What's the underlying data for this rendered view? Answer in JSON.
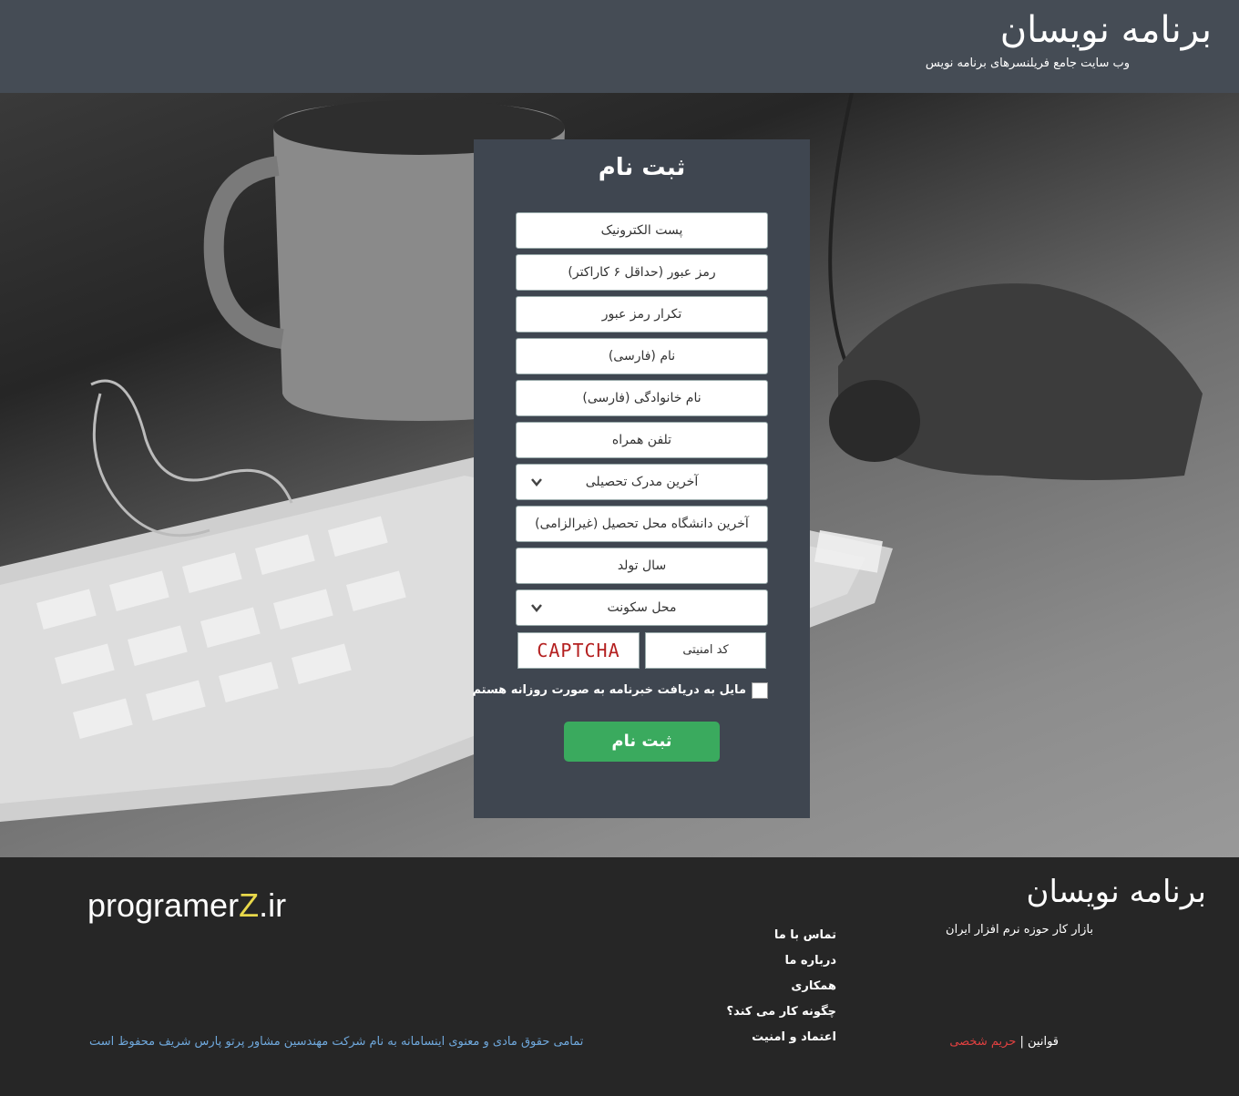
{
  "header": {
    "logo": "برنامه نویسان",
    "tagline": "وب سایت جامع فریلنسرهای برنامه نویس"
  },
  "form": {
    "title": "ثبت نام",
    "fields": [
      "پست الکترونیک",
      "رمز عبور (حداقل ۶ کاراکتر)",
      "تکرار رمز عبور",
      "نام (فارسی)",
      "نام خانوادگی (فارسی)",
      "تلفن همراه"
    ],
    "education_select": "آخرین مدرک تحصیلی",
    "university_field": "آخرین دانشگاه محل تحصیل (غیرالزامی)",
    "birth_year_field": "سال تولد",
    "residence_select": "محل سکونت",
    "captcha_placeholder": "کد امنیتی",
    "captcha_text": "CAPTCHA",
    "newsletter_label": "مایل به دریافت خبرنامه به صورت روزانه هستم",
    "submit_label": "ثبت نام"
  },
  "footer": {
    "logo": "برنامه نویسان",
    "tagline": "بازار کار حوزه نرم افزار ایران",
    "links": [
      "تماس با ما",
      "درباره ما",
      "همکاری",
      "چگونه کار می کند؟",
      "اعتماد و امنیت"
    ],
    "rules": "قوانین",
    "separator": "|",
    "privacy": "حریم شخصی",
    "copyright": "تمامی حقوق مادی و معنوی اینسامانه به نام شرکت مهندسین مشاور پرتو پارس شریف محفوظ است",
    "brand_prefix": "programer",
    "brand_z": "Z",
    "brand_suffix": ".ir"
  },
  "colors": {
    "header_bg": "#454c55",
    "panel_bg": "#3f4650",
    "submit_bg": "#3aaa5e",
    "footer_bg": "#262626",
    "copyright_text": "#6fa8dc",
    "privacy_text": "#e04040",
    "brand_z": "#e8d84a"
  }
}
